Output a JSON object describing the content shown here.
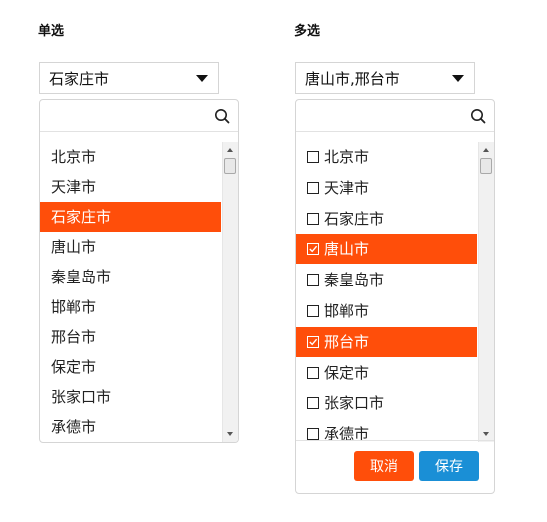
{
  "single": {
    "title": "单选",
    "selected_value": "石家庄市",
    "search": {
      "placeholder": ""
    },
    "items": [
      {
        "label": "北京市",
        "selected": false
      },
      {
        "label": "天津市",
        "selected": false
      },
      {
        "label": "石家庄市",
        "selected": true
      },
      {
        "label": "唐山市",
        "selected": false
      },
      {
        "label": "秦皇岛市",
        "selected": false
      },
      {
        "label": "邯郸市",
        "selected": false
      },
      {
        "label": "邢台市",
        "selected": false
      },
      {
        "label": "保定市",
        "selected": false
      },
      {
        "label": "张家口市",
        "selected": false
      },
      {
        "label": "承德市",
        "selected": false
      }
    ]
  },
  "multi": {
    "title": "多选",
    "selected_value": "唐山市,邢台市",
    "search": {
      "placeholder": ""
    },
    "items": [
      {
        "label": "北京市",
        "checked": false
      },
      {
        "label": "天津市",
        "checked": false
      },
      {
        "label": "石家庄市",
        "checked": false
      },
      {
        "label": "唐山市",
        "checked": true
      },
      {
        "label": "秦皇岛市",
        "checked": false
      },
      {
        "label": "邯郸市",
        "checked": false
      },
      {
        "label": "邢台市",
        "checked": true
      },
      {
        "label": "保定市",
        "checked": false
      },
      {
        "label": "张家口市",
        "checked": false
      },
      {
        "label": "承德市",
        "checked": false
      }
    ],
    "cancel_label": "取消",
    "save_label": "保存"
  },
  "colors": {
    "accent": "#ff4e0a",
    "primary": "#1a8fd6",
    "border": "#d5d5d5"
  },
  "icons": {
    "search": "search-icon",
    "caret": "caret-down-icon",
    "checkbox": "checkbox-icon",
    "checkmark": "check-icon"
  }
}
